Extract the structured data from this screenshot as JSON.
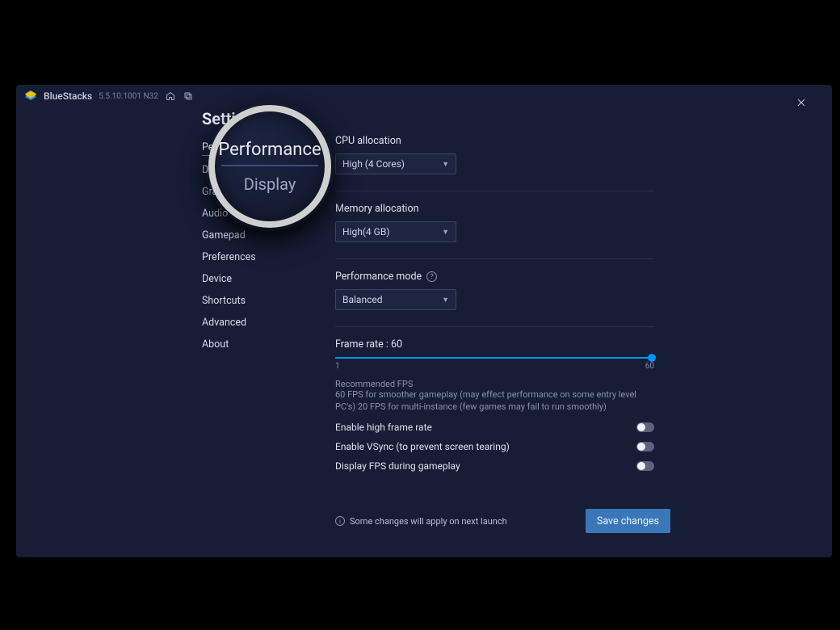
{
  "titlebar": {
    "app_name": "BlueStacks",
    "version": "5.5.10.1001 N32"
  },
  "page_title": "Settings",
  "sidebar": {
    "items": [
      {
        "label": "Performance",
        "active": true
      },
      {
        "label": "Display"
      },
      {
        "label": "Graphics"
      },
      {
        "label": "Audio"
      },
      {
        "label": "Gamepad"
      },
      {
        "label": "Preferences"
      },
      {
        "label": "Device"
      },
      {
        "label": "Shortcuts"
      },
      {
        "label": "Advanced"
      },
      {
        "label": "About"
      }
    ]
  },
  "cpu": {
    "label": "CPU allocation",
    "value": "High (4 Cores)"
  },
  "memory": {
    "label": "Memory allocation",
    "value": "High(4 GB)"
  },
  "perfmode": {
    "label": "Performance mode",
    "value": "Balanced"
  },
  "framerate": {
    "label": "Frame rate : 60",
    "min": "1",
    "max": "60",
    "value": 60
  },
  "recommended": {
    "head": "Recommended FPS",
    "body": "60 FPS for smoother gameplay (may effect performance on some entry level PC's) 20 FPS for multi-instance (few games may fail to run smoothly)"
  },
  "toggles": {
    "high_frame": {
      "label": "Enable high frame rate",
      "on": false
    },
    "vsync": {
      "label": "Enable VSync (to prevent screen tearing)",
      "on": false
    },
    "display_fps": {
      "label": "Display FPS during gameplay",
      "on": false
    }
  },
  "footer": {
    "note": "Some changes will apply on next launch",
    "save": "Save changes"
  },
  "magnifier": {
    "top": "Performance",
    "bottom": "Display"
  }
}
